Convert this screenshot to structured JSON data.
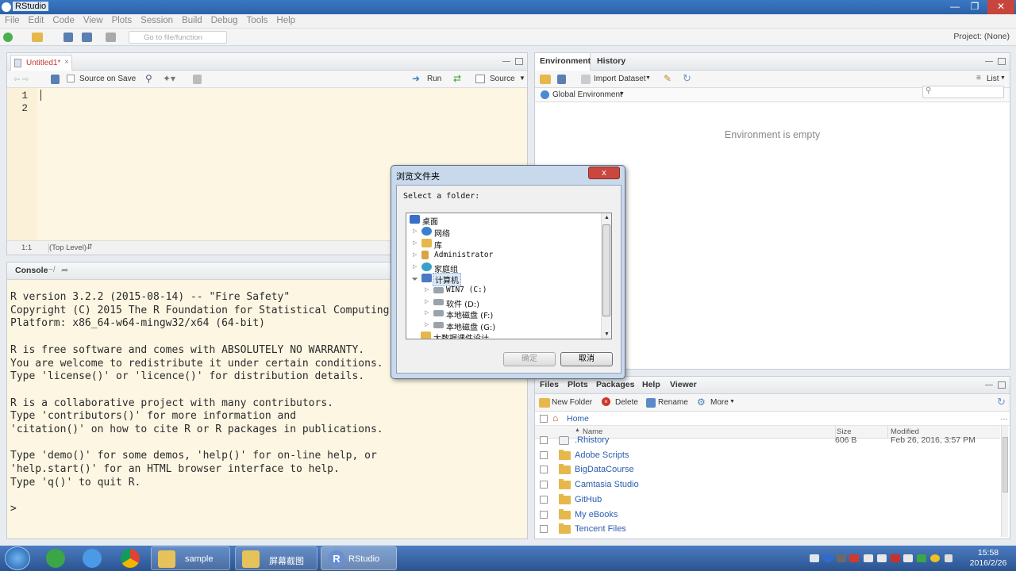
{
  "window": {
    "title": "RStudio"
  },
  "menu": [
    "File",
    "Edit",
    "Code",
    "View",
    "Plots",
    "Session",
    "Build",
    "Debug",
    "Tools",
    "Help"
  ],
  "toolbar": {
    "goto_placeholder": "Go to file/function",
    "project": "Project: (None)"
  },
  "editor": {
    "tab": "Untitled1*",
    "source_on_save": "Source on Save",
    "run": "Run",
    "source": "Source",
    "lines": [
      "1",
      "2"
    ],
    "cursor_pos": "1:1",
    "scope": "(Top Level)"
  },
  "console": {
    "title": "Console",
    "path": "~/",
    "output": "R version 3.2.2 (2015-08-14) -- \"Fire Safety\"\nCopyright (C) 2015 The R Foundation for Statistical Computing\nPlatform: x86_64-w64-mingw32/x64 (64-bit)\n\nR is free software and comes with ABSOLUTELY NO WARRANTY.\nYou are welcome to redistribute it under certain conditions.\nType 'license()' or 'licence()' for distribution details.\n\nR is a collaborative project with many contributors.\nType 'contributors()' for more information and\n'citation()' on how to cite R or R packages in publications.\n\nType 'demo()' for some demos, 'help()' for on-line help, or\n'help.start()' for an HTML browser interface to help.\nType 'q()' to quit R.\n\n> "
  },
  "environment": {
    "tabs": [
      "Environment",
      "History"
    ],
    "import_dataset": "Import Dataset",
    "list": "List",
    "global_env": "Global Environment",
    "empty_msg": "Environment is empty"
  },
  "files": {
    "tabs": [
      "Files",
      "Plots",
      "Packages",
      "Help",
      "Viewer"
    ],
    "new_folder": "New Folder",
    "delete": "Delete",
    "rename": "Rename",
    "more": "More",
    "home": "Home",
    "col_name": "Name",
    "col_size": "Size",
    "col_modified": "Modified",
    "rows": [
      {
        "name": ".Rhistory",
        "size": "606 B",
        "modified": "Feb 26, 2016, 3:57 PM"
      },
      {
        "name": "Adobe Scripts",
        "size": "",
        "modified": ""
      },
      {
        "name": "BigDataCourse",
        "size": "",
        "modified": ""
      },
      {
        "name": "Camtasia Studio",
        "size": "",
        "modified": ""
      },
      {
        "name": "GitHub",
        "size": "",
        "modified": ""
      },
      {
        "name": "My eBooks",
        "size": "",
        "modified": ""
      },
      {
        "name": "Tencent Files",
        "size": "",
        "modified": ""
      }
    ]
  },
  "dialog": {
    "title": "浏览文件夹",
    "close": "x",
    "prompt": "Select a folder:",
    "tree": [
      {
        "label": "桌面",
        "level": 0,
        "icon_color": "#3a6fc8"
      },
      {
        "label": "网络",
        "level": 1,
        "icon_color": "#3a80d0"
      },
      {
        "label": "库",
        "level": 1,
        "icon_color": "#e6b84c"
      },
      {
        "label": "Administrator",
        "level": 1,
        "icon_color": "#d9a441"
      },
      {
        "label": "家庭组",
        "level": 1,
        "icon_color": "#3aa0c8"
      },
      {
        "label": "计算机",
        "level": 1,
        "icon_color": "#4a7ac0"
      },
      {
        "label": "WIN7 (C:)",
        "level": 2,
        "icon_color": "#9aa3ab"
      },
      {
        "label": "软件 (D:)",
        "level": 2,
        "icon_color": "#9aa3ab"
      },
      {
        "label": "本地磁盘 (F:)",
        "level": 2,
        "icon_color": "#9aa3ab"
      },
      {
        "label": "本地磁盘 (G:)",
        "level": 2,
        "icon_color": "#9aa3ab"
      },
      {
        "label": "大数据课件设计",
        "level": 1,
        "icon_color": "#e6b84c"
      }
    ],
    "ok": "确定",
    "cancel": "取消"
  },
  "taskbar": {
    "items": [
      {
        "label": "sample",
        "color": "#e6c25a"
      },
      {
        "label": "屏幕截图",
        "color": "#e6c25a"
      },
      {
        "label": "RStudio",
        "color": "#6a8fd0"
      }
    ],
    "time": "15:58",
    "date": "2016/2/26"
  }
}
